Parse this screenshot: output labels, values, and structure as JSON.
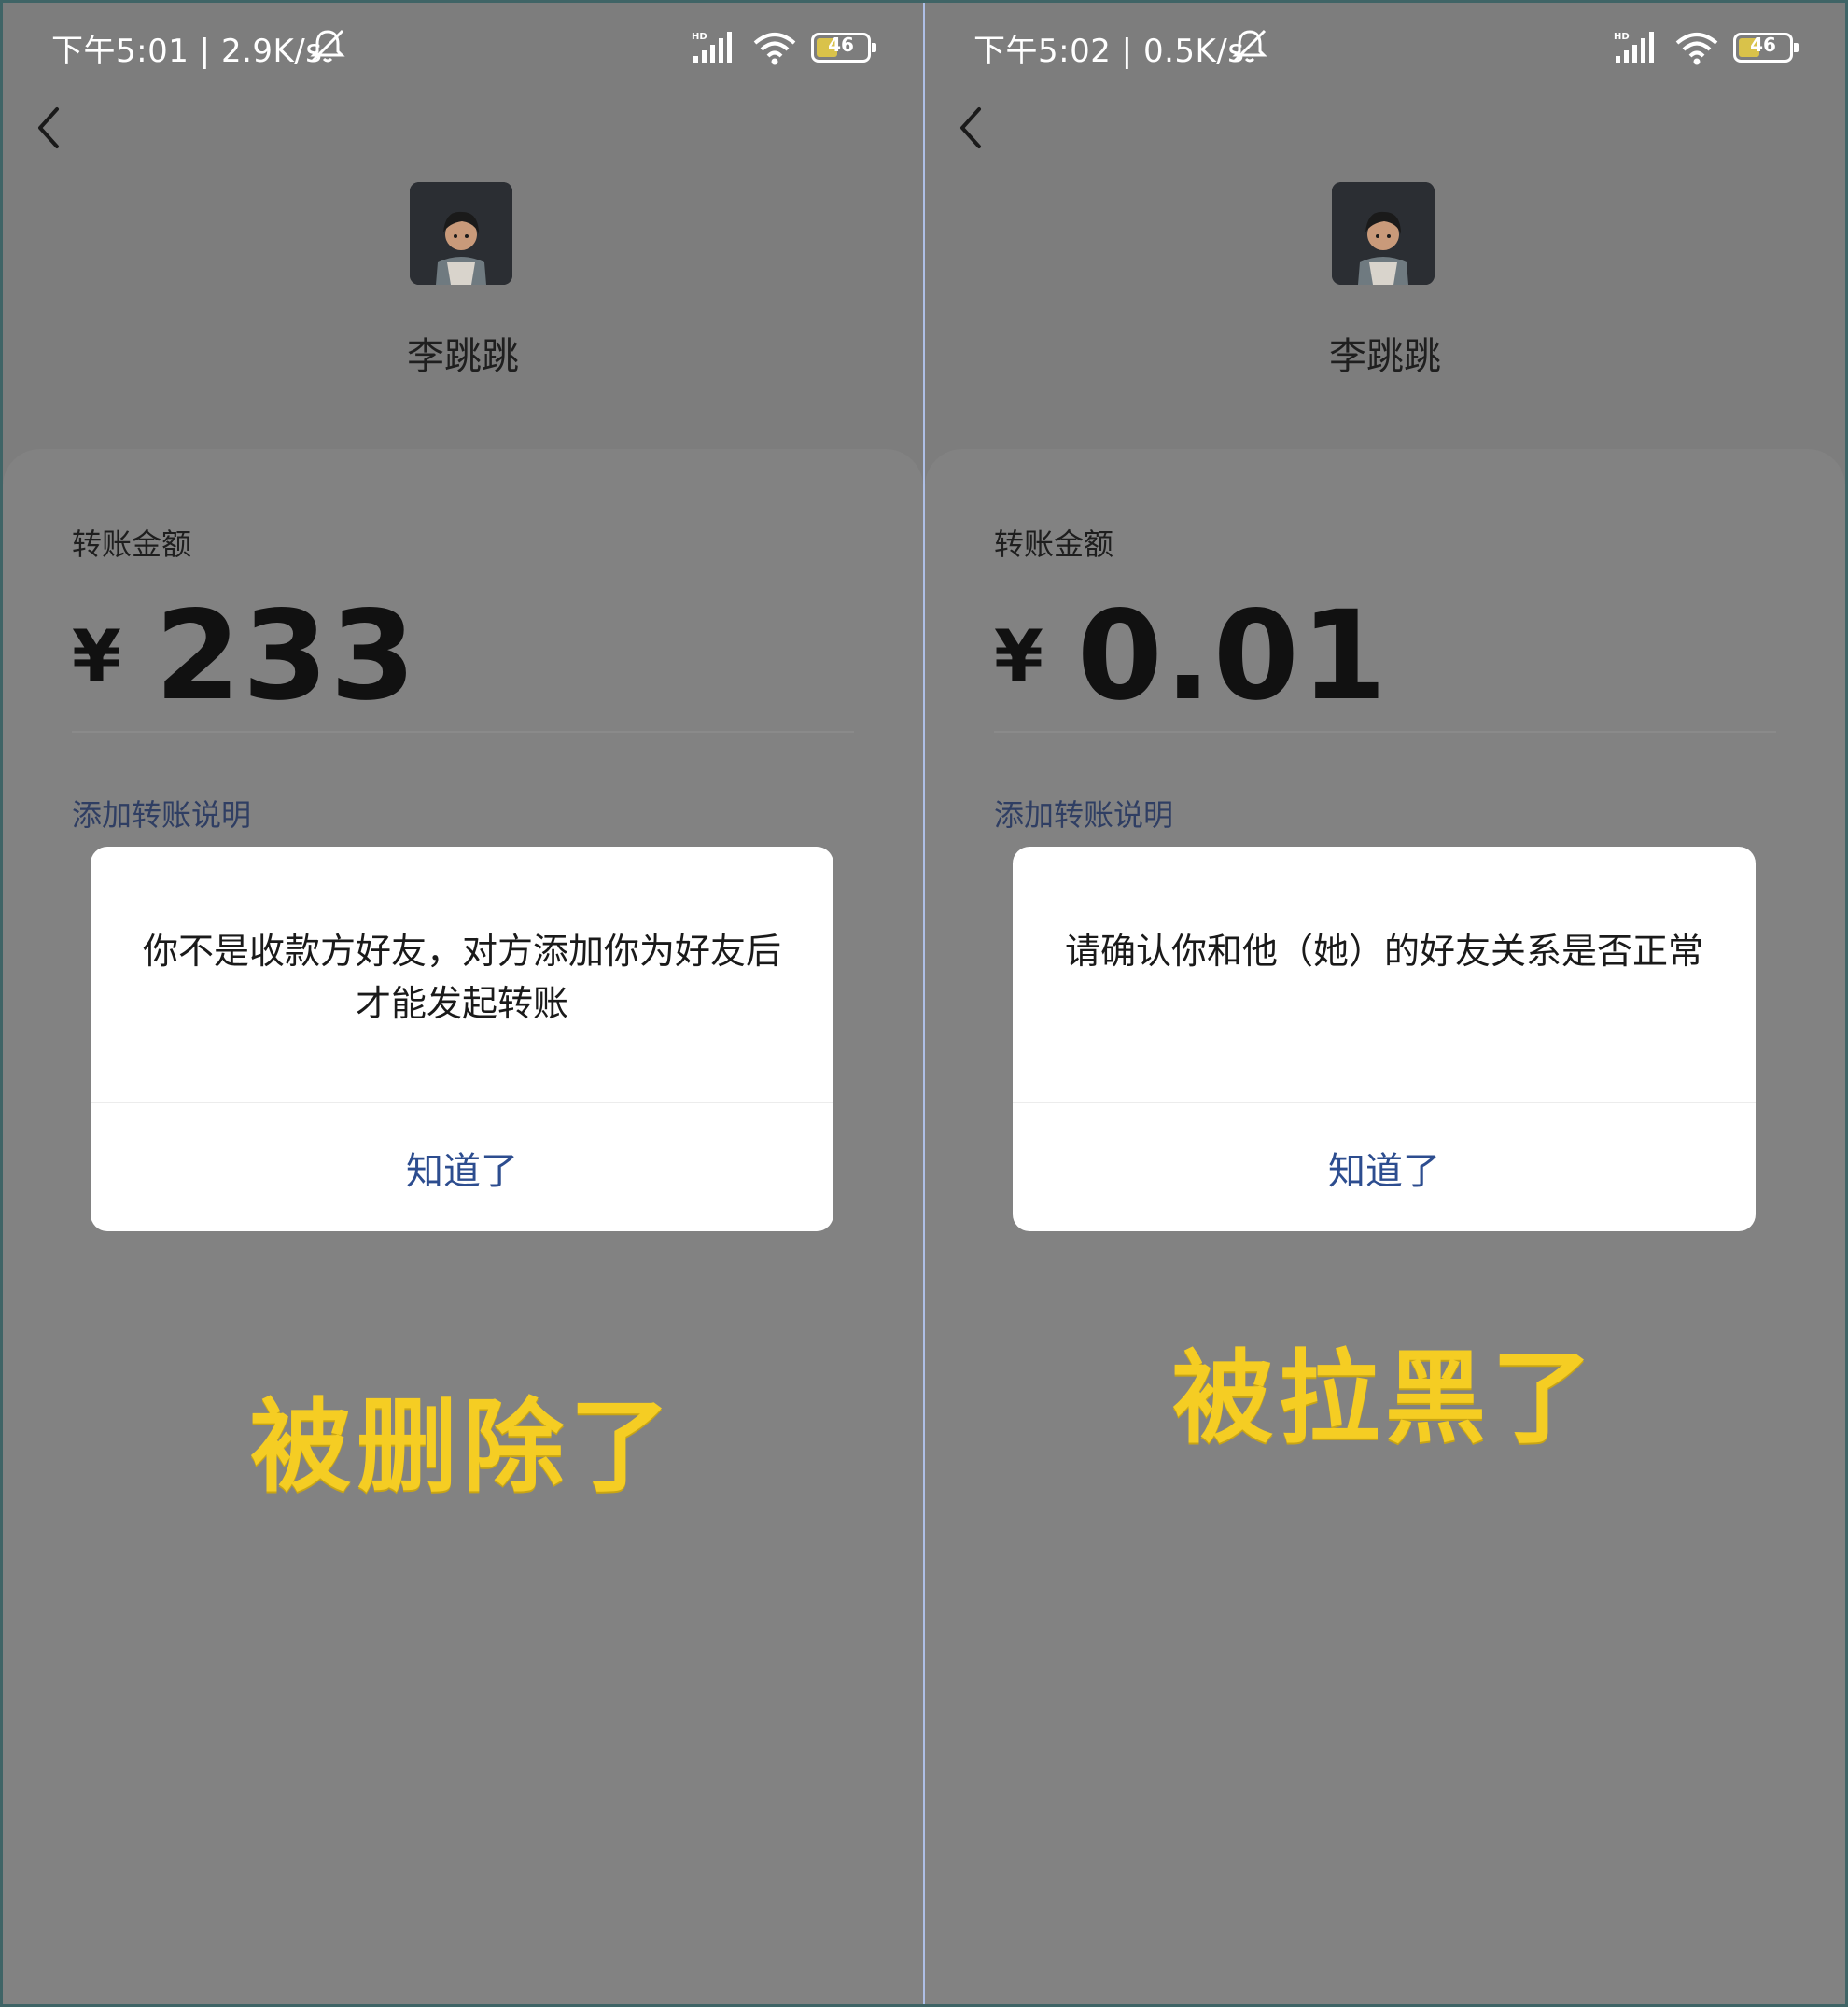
{
  "panels": [
    {
      "status": {
        "time": "下午5:01",
        "speed": "2.9K/s",
        "battery": "46"
      },
      "payee": {
        "name": "李跳跳"
      },
      "amount": {
        "label": "转账金额",
        "currency": "¥",
        "value": "233"
      },
      "note_link": "添加转账说明",
      "dialog": {
        "message": "你不是收款方好友，对方添加你为好友后才能发起转账",
        "button": "知道了"
      },
      "caption": "被删除了"
    },
    {
      "status": {
        "time": "下午5:02",
        "speed": "0.5K/s",
        "battery": "46"
      },
      "payee": {
        "name": "李跳跳"
      },
      "amount": {
        "label": "转账金额",
        "currency": "¥",
        "value": "0.01"
      },
      "note_link": "添加转账说明",
      "dialog": {
        "message": "请确认你和他（她）的好友关系是否正常",
        "button": "知道了"
      },
      "caption": "被拉黑了"
    }
  ],
  "icons": {
    "status": [
      "mute-icon",
      "signal-icon",
      "wifi-icon",
      "battery-icon"
    ],
    "nav": [
      "back-icon"
    ]
  },
  "colors": {
    "background_overlay": "#7d7d7d",
    "caption": "#f5cd23",
    "link": "#2f3e63",
    "dialog_button": "#2d4d8f",
    "frame": "#3f6466"
  }
}
